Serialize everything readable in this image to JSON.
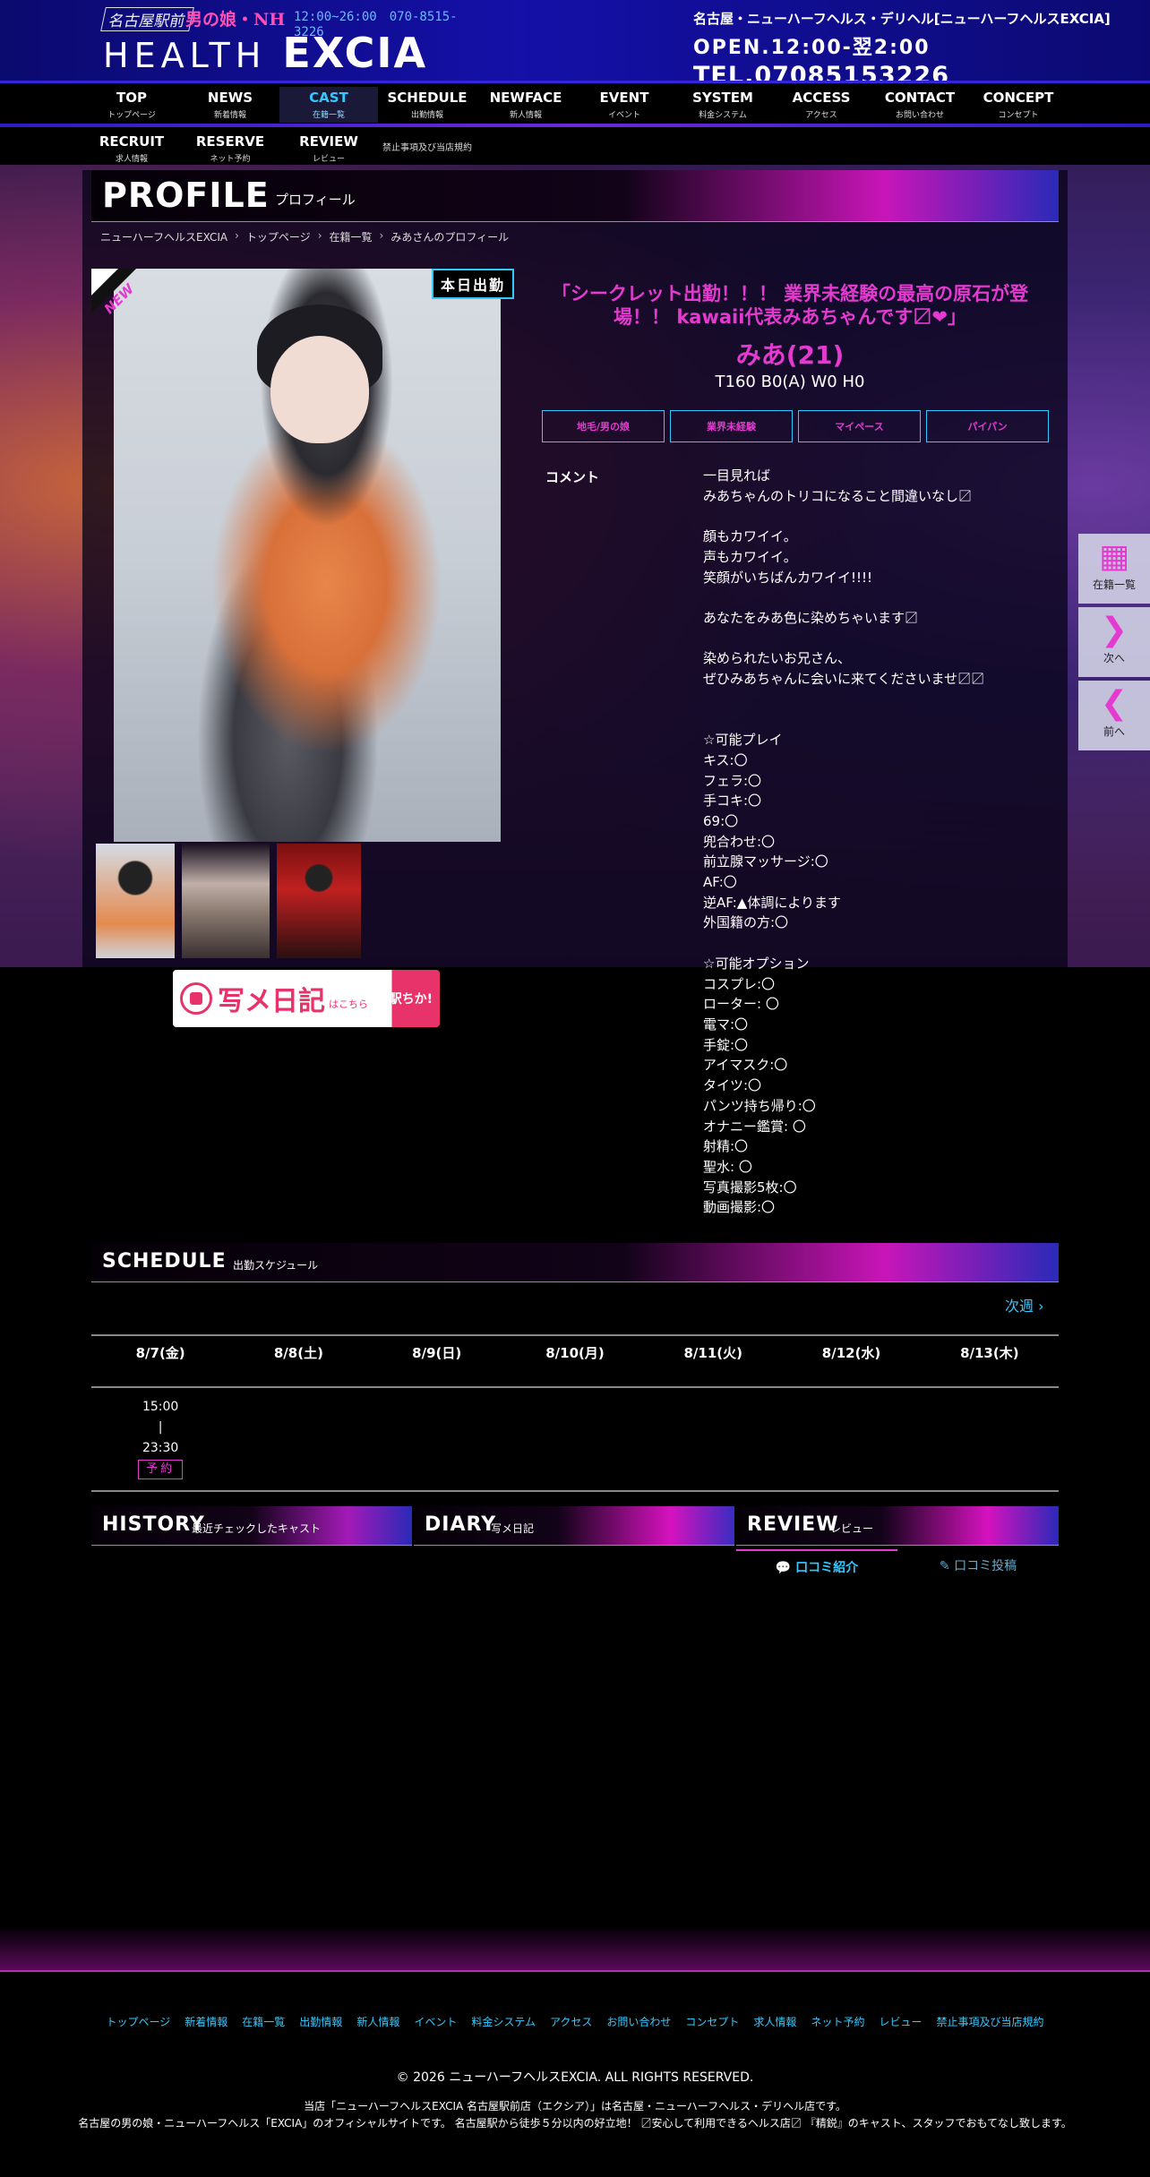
{
  "header": {
    "station_tag": "名古屋駅前",
    "category_tag": "男の娘・NH",
    "hours_tag": "12:00~26:00　070-8515-3226",
    "logo_prefix": "HEALTH",
    "logo_name": "EXCIA",
    "shop_line": "名古屋・ニューハーフヘルス・デリヘル[ニューハーフヘルスEXCIA]",
    "open_line": "OPEN.12:00-翌2:00",
    "tel_line": "TEL.07085153226"
  },
  "nav": {
    "row1": [
      {
        "en": "TOP",
        "ja": "トップページ"
      },
      {
        "en": "NEWS",
        "ja": "新着情報"
      },
      {
        "en": "CAST",
        "ja": "在籍一覧"
      },
      {
        "en": "SCHEDULE",
        "ja": "出勤情報"
      },
      {
        "en": "NEWFACE",
        "ja": "新人情報"
      },
      {
        "en": "EVENT",
        "ja": "イベント"
      },
      {
        "en": "SYSTEM",
        "ja": "料金システム"
      },
      {
        "en": "ACCESS",
        "ja": "アクセス"
      },
      {
        "en": "CONTACT",
        "ja": "お問い合わせ"
      },
      {
        "en": "CONCEPT",
        "ja": "コンセプト"
      }
    ],
    "row2": [
      {
        "en": "RECRUIT",
        "ja": "求人情報"
      },
      {
        "en": "RESERVE",
        "ja": "ネット予約"
      },
      {
        "en": "REVIEW",
        "ja": "レビュー"
      }
    ],
    "terms": "禁止事項及び当店規約"
  },
  "profile": {
    "title_en": "PROFILE",
    "title_ja": "プロフィール",
    "breadcrumb": [
      "ニューハーフヘルスEXCIA",
      "トップページ",
      "在籍一覧",
      "みあさんのプロフィール"
    ],
    "new_badge": "NEW",
    "today_badge": "本日出勤",
    "catch": "「シークレット出勤！！！ 業界未経験の最高の原石が登場！！ kawaii代表みあちゃんです〼❤」",
    "name": "みあ(21)",
    "size": "T160 B0(A) W0 H0",
    "tags": [
      "地毛/男の娘",
      "業界未経験",
      "マイペース",
      "パイパン"
    ],
    "comment_label": "コメント",
    "comment": "一目見れば\nみあちゃんのトリコになること間違いなし〼\n\n顔もカワイイ。\n声もカワイイ。\n笑顔がいちばんカワイイ!!!!\n\nあなたをみあ色に染めちゃいます〼\n\n染められたいお兄さん、\nぜひみあちゃんに会いに来てくださいませ〼〼\n\n\n☆可能プレイ\nキス:〇\nフェラ:〇\n手コキ:〇\n69:〇\n兜合わせ:〇\n前立腺マッサージ:〇\nAF:〇\n逆AF:▲体調によります\n外国籍の方:〇\n\n☆可能オプション\nコスプレ:〇\nローター: 〇\n電マ:〇\n手錠:〇\nアイマスク:〇\nタイツ:〇\nパンツ持ち帰り:〇\nオナニー鑑賞: 〇\n射精:〇\n聖水: 〇\n写真撮影5枚:〇\n動画撮影:〇",
    "diary_banner": {
      "main": "写メ日記",
      "sub": "はこちら",
      "go": "駅ちか!"
    }
  },
  "schedule": {
    "title_en": "SCHEDULE",
    "title_ja": "出勤スケジュール",
    "next_week": "次週 ›",
    "days": [
      "8/7(金)",
      "8/8(土)",
      "8/9(日)",
      "8/10(月)",
      "8/11(火)",
      "8/12(水)",
      "8/13(木)"
    ],
    "slot_start": "15:00",
    "slot_sep": "|",
    "slot_end": "23:30",
    "reserve": "予約"
  },
  "boxes": {
    "history_en": "HISTORY",
    "history_ja": "最近チェックしたキャスト",
    "diary_en": "DIARY",
    "diary_ja": "写メ日記",
    "review_en": "REVIEW",
    "review_ja": "レビュー",
    "review_tab_on": "口コミ紹介",
    "review_tab_off": "口コミ投稿"
  },
  "side": {
    "list": "在籍一覧",
    "next": "次へ",
    "prev": "前へ"
  },
  "footer": {
    "links": [
      "トップページ",
      "新着情報",
      "在籍一覧",
      "出勤情報",
      "新人情報",
      "イベント",
      "料金システム",
      "アクセス",
      "お問い合わせ",
      "コンセプト",
      "求人情報",
      "ネット予約",
      "レビュー",
      "禁止事項及び当店規約"
    ],
    "copyright": "© 2026 ニューハーフヘルスEXCIA. ALL RIGHTS RESERVED.",
    "desc1": "当店「ニューハーフヘルスEXCIA 名古屋駅前店（エクシア）」は名古屋・ニューハーフヘルス・デリヘル店です。",
    "desc2": "名古屋の男の娘・ニューハーフヘルス「EXCIA」のオフィシャルサイトです。 名古屋駅から徒歩５分以内の好立地！ 〼安心して利用できるヘルス店〼 『精鋭』のキャスト、スタッフでおもてなし致します。"
  },
  "colors": {
    "accent_pink": "#e43ad0",
    "accent_cyan": "#35c8ff",
    "header_blue": "#1410a8"
  }
}
